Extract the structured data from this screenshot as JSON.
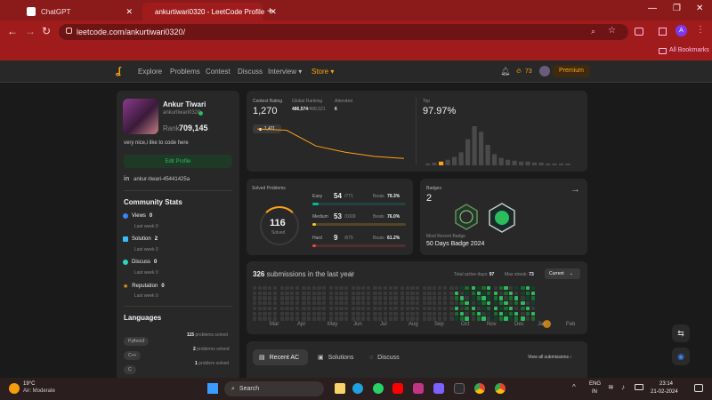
{
  "browser": {
    "tabs": [
      {
        "title": "ChatGPT",
        "active": false
      },
      {
        "title": "ankurtiwari0320 - LeetCode Profile",
        "active": true
      }
    ],
    "new_tab_glyph": "+",
    "url": "leetcode.com/ankurtiwari0320/",
    "bookmarks_label": "All Bookmarks",
    "profile_initial": "A",
    "accent": "#8b1a1a"
  },
  "lc_nav": {
    "items": [
      "Explore",
      "Problems",
      "Contest",
      "Discuss",
      "Interview ▾",
      "Store ▾"
    ],
    "streak": "73",
    "premium": "Premium"
  },
  "profile": {
    "name": "Ankur Tiwari",
    "username": "ankurtiwari0320",
    "rank_label": "Rank",
    "rank": "709,145",
    "bio": "very nice,i like to code here",
    "edit_label": "Edit Profile",
    "linkedin": "ankur-tiwari-45441425a"
  },
  "community": {
    "title": "Community Stats",
    "items": [
      {
        "label": "Views",
        "value": "0",
        "sub": "Last week 0",
        "color": "#3b82f6"
      },
      {
        "label": "Solution",
        "value": "2",
        "sub": "Last week 0",
        "color": "#38bdf8"
      },
      {
        "label": "Discuss",
        "value": "0",
        "sub": "Last week 0",
        "color": "#2dd4bf"
      },
      {
        "label": "Reputation",
        "value": "0",
        "sub": "Last week 0",
        "color": "#f59e0b"
      }
    ]
  },
  "languages": {
    "title": "Languages",
    "items": [
      {
        "name": "Python3",
        "count": "115",
        "suffix": "problems solved"
      },
      {
        "name": "C++",
        "count": "2",
        "suffix": "problems solved"
      },
      {
        "name": "C",
        "count": "1",
        "suffix": "problem solved"
      }
    ]
  },
  "contest": {
    "rating_label": "Contest Rating",
    "rating": "1,270",
    "global_label": "Global Ranking",
    "global_rank": "486,574",
    "global_total": "/498,521",
    "attended_label": "Attended",
    "attended": "6",
    "tooltip": "1,411",
    "top_label": "Top",
    "top": "97.97%",
    "rating_line": [
      1411,
      1405,
      1330,
      1300,
      1280,
      1270
    ],
    "histogram": [
      2,
      3,
      4,
      6,
      9,
      14,
      28,
      42,
      36,
      22,
      12,
      8,
      6,
      5,
      4,
      4,
      3,
      3,
      2,
      2,
      2,
      2
    ]
  },
  "solved": {
    "title": "Solved Problems",
    "total": "116",
    "total_label": "Solved",
    "rows": [
      {
        "label": "Easy",
        "count": "54",
        "total": "/771",
        "beats_label": "Beats",
        "beats": "79.3%",
        "fill": 0.07,
        "color": "#00b8a3"
      },
      {
        "label": "Medium",
        "count": "53",
        "total": "/1609",
        "beats_label": "Beats",
        "beats": "76.0%",
        "fill": 0.033,
        "color": "#ffc01e"
      },
      {
        "label": "Hard",
        "count": "9",
        "total": "/675",
        "beats_label": "Beats",
        "beats": "61.2%",
        "fill": 0.013,
        "color": "#ef4743"
      }
    ]
  },
  "badges": {
    "title": "Badges",
    "count": "2",
    "recent_label": "Most Recent Badge",
    "recent": "50 Days Badge 2024"
  },
  "submissions": {
    "count": "326",
    "label": "submissions in the last year",
    "active_label": "Total active days:",
    "active": "97",
    "streak_label": "Max streak:",
    "streak": "73",
    "dropdown": "Current",
    "months": [
      "Mar",
      "Apr",
      "May",
      "Jun",
      "Jul",
      "Aug",
      "Sep",
      "Oct",
      "Nov",
      "Dec",
      "Jan",
      "Feb"
    ]
  },
  "tabs": {
    "items": [
      "Recent AC",
      "Solutions",
      "Discuss"
    ],
    "view_all": "View all submissions"
  },
  "taskbar": {
    "temp": "19°C",
    "weather": "Air: Moderate",
    "search": "Search",
    "lang1": "ENG",
    "lang2": "IN",
    "time": "23:14",
    "date": "21-02-2024"
  }
}
